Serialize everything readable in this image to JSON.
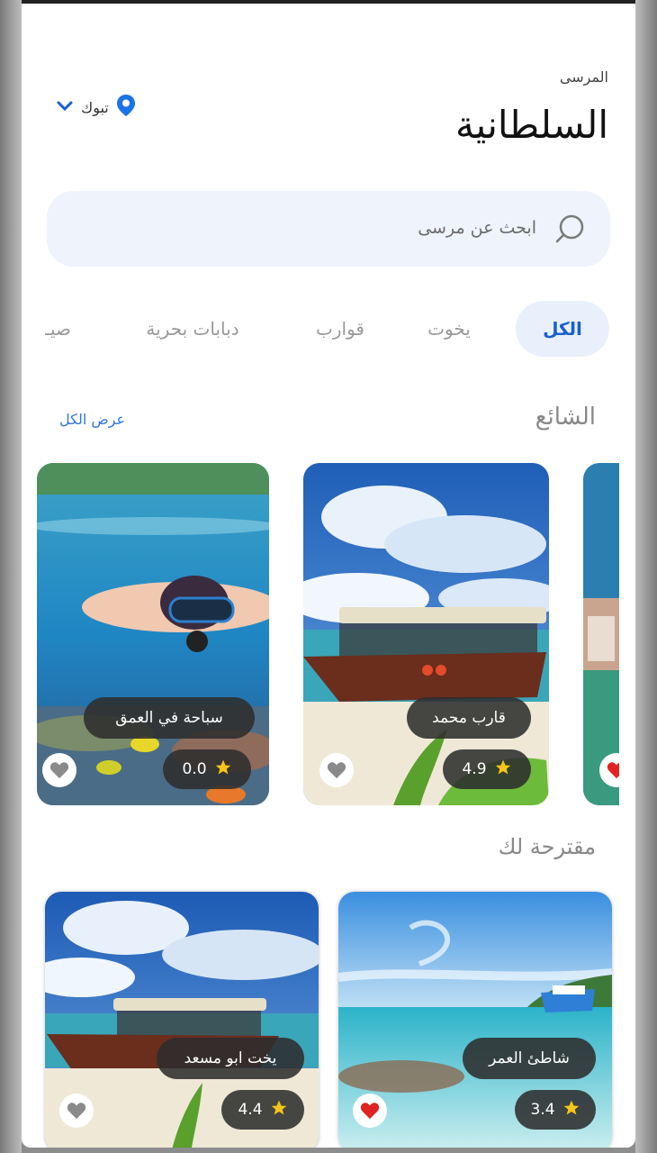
{
  "header": {
    "subtitle": "المرسى",
    "title": "السلطانية",
    "location": "تبوك"
  },
  "search": {
    "placeholder": "ابحث عن مرسى"
  },
  "tabs": [
    {
      "label": "الكل",
      "active": true
    },
    {
      "label": "يخوت"
    },
    {
      "label": "قوارب"
    },
    {
      "label": "دبابات بحرية"
    },
    {
      "label": "صيـ"
    }
  ],
  "popular": {
    "title": "الشائع",
    "see_all": "عرض الكل",
    "cards": [
      {
        "name": "قارب محمد",
        "rating": "4.9",
        "favorite": false
      },
      {
        "name": "سباحة في العمق",
        "rating": "0.0",
        "favorite": false
      },
      {
        "favorite": true
      }
    ]
  },
  "suggested": {
    "title": "مقترحة لك",
    "cards": [
      {
        "name": "شاطئ العمر",
        "rating": "3.4",
        "favorite": true
      },
      {
        "name": "يخت ابو مسعد",
        "rating": "4.4",
        "favorite": false
      }
    ]
  },
  "colors": {
    "accent": "#1a5fd0",
    "star": "#f5c518",
    "heart_active": "#e02424",
    "heart_inactive": "#8a8a8a"
  }
}
